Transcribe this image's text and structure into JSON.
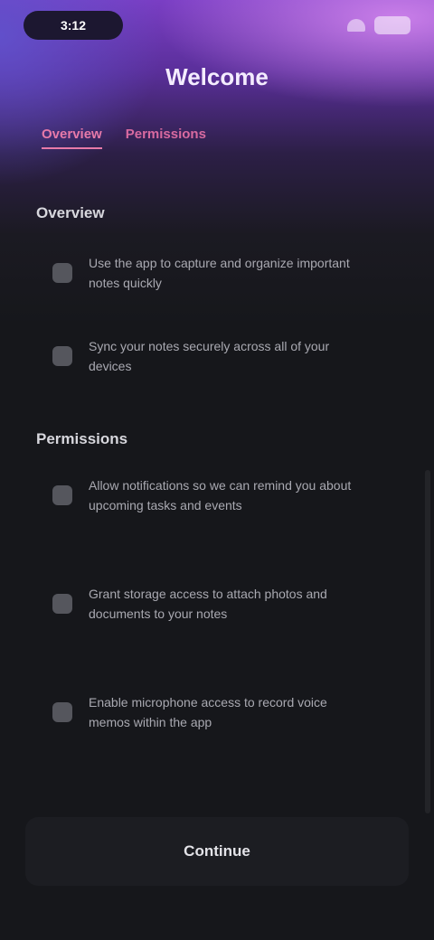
{
  "status": {
    "time": "3:12"
  },
  "title": "Welcome",
  "tabs": [
    {
      "label": "Overview",
      "active": true
    },
    {
      "label": "Permissions",
      "active": false
    }
  ],
  "sections": [
    {
      "title": "Overview",
      "items": [
        "Use the app to capture and organize important notes quickly",
        "Sync your notes securely across all of your devices"
      ]
    },
    {
      "title": "Permissions",
      "items": [
        "Allow notifications so we can remind you about upcoming tasks and events",
        "Grant storage access to attach photos and documents to your notes",
        "Enable microphone access to record voice memos within the app"
      ]
    }
  ],
  "footer": {
    "button_label": "Continue"
  },
  "colors": {
    "accent": "#e77aa9",
    "background": "#16171b",
    "header_top": "#7a3ec4"
  }
}
